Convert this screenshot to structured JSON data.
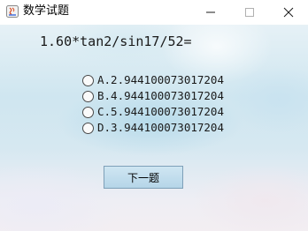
{
  "window": {
    "title": "数学试题",
    "controls": {
      "minimize_icon": "minimize-icon",
      "maximize_icon": "maximize-icon",
      "close_icon": "close-icon"
    }
  },
  "question": {
    "text": "1.60*tan2/sin17/52="
  },
  "options": [
    {
      "label": "A.2.944100073017204",
      "selected": false
    },
    {
      "label": "B.4.944100073017204",
      "selected": false
    },
    {
      "label": "C.5.944100073017204",
      "selected": false
    },
    {
      "label": "D.3.944100073017204",
      "selected": false
    }
  ],
  "actions": {
    "next_label": "下一题"
  },
  "colors": {
    "accent": "#b5d5e8",
    "button_border": "#7ea0b8"
  }
}
